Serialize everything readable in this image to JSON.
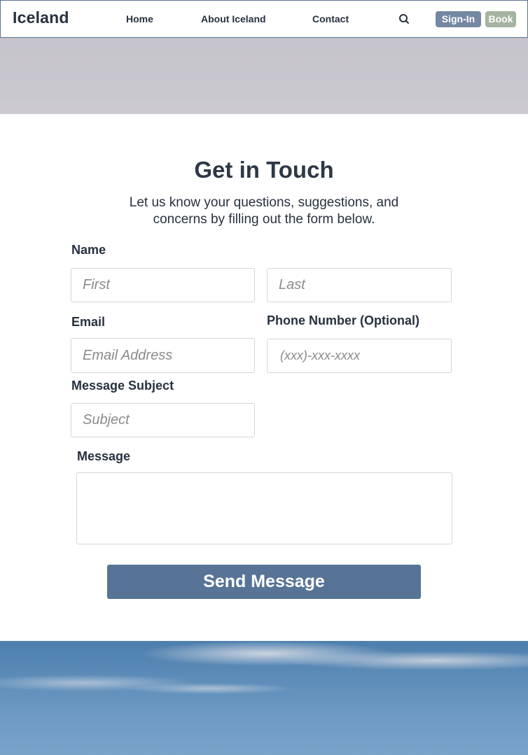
{
  "nav": {
    "logo": "Iceland",
    "links": [
      {
        "label": "Home"
      },
      {
        "label": "About Iceland"
      },
      {
        "label": "Contact"
      }
    ],
    "search_icon": "search-icon",
    "signin_label": "Sign-In",
    "book_label": "Book"
  },
  "contact": {
    "title": "Get in Touch",
    "subtitle_line1": "Let us know your questions, suggestions, and",
    "subtitle_line2": "concerns by filling out the form below.",
    "name_label": "Name",
    "first_placeholder": "First",
    "last_placeholder": "Last",
    "email_label": "Email",
    "email_placeholder": "Email Address",
    "phone_label": "Phone Number (Optional)",
    "phone_placeholder": "(xxx)-xxx-xxxx",
    "subject_label": "Message Subject",
    "subject_placeholder": "Subject",
    "message_label": "Message",
    "message_value": "",
    "send_label": "Send Message"
  },
  "colors": {
    "primary": "#577497",
    "signin": "#7588a3",
    "book": "#a4b4a0",
    "text": "#27313f"
  }
}
